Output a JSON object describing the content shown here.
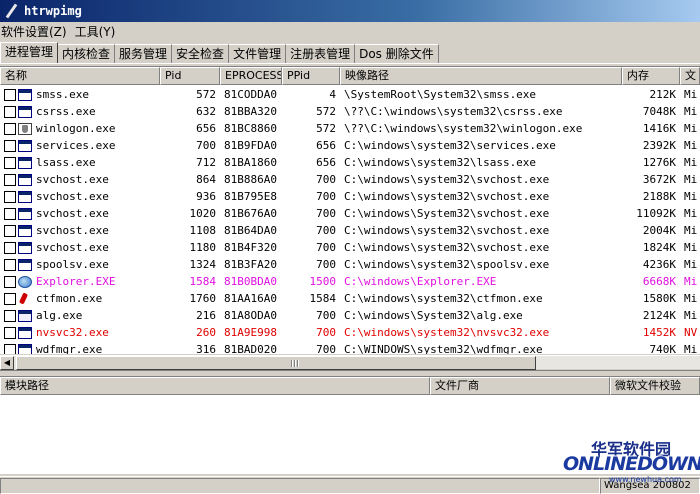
{
  "window": {
    "title": "htrwpimg"
  },
  "menu": [
    "软件设置(Z)",
    "工具(Y)"
  ],
  "tabs": [
    "进程管理",
    "内核检查",
    "服务管理",
    "安全检查",
    "文件管理",
    "注册表管理",
    "Dos 删除文件"
  ],
  "columns": [
    "名称",
    "Pid",
    "EPROCESS",
    "PPid",
    "映像路径",
    "内存",
    "文"
  ],
  "colors": {
    "highlight_magenta": "#e010e0",
    "highlight_red": "#e00000",
    "title_bar": "#0a246a"
  },
  "processes": [
    {
      "name": "smss.exe",
      "pid": "572",
      "eprocess": "81CODDA0",
      "ppid": "4",
      "path": "\\SystemRoot\\System32\\smss.exe",
      "mem": "212K",
      "ver": "Mi",
      "icon": "window-icon",
      "color": ""
    },
    {
      "name": "csrss.exe",
      "pid": "632",
      "eprocess": "81BBA320",
      "ppid": "572",
      "path": "\\??\\C:\\windows\\system32\\csrss.exe",
      "mem": "7048K",
      "ver": "Mi",
      "icon": "window-icon",
      "color": ""
    },
    {
      "name": "winlogon.exe",
      "pid": "656",
      "eprocess": "81BC8860",
      "ppid": "572",
      "path": "\\??\\C:\\windows\\system32\\winlogon.exe",
      "mem": "1416K",
      "ver": "Mi",
      "icon": "shield-icon",
      "color": ""
    },
    {
      "name": "services.exe",
      "pid": "700",
      "eprocess": "81B9FDA0",
      "ppid": "656",
      "path": "C:\\windows\\system32\\services.exe",
      "mem": "2392K",
      "ver": "Mi",
      "icon": "window-icon",
      "color": ""
    },
    {
      "name": "lsass.exe",
      "pid": "712",
      "eprocess": "81BA1860",
      "ppid": "656",
      "path": "C:\\windows\\system32\\lsass.exe",
      "mem": "1276K",
      "ver": "Mi",
      "icon": "window-icon",
      "color": ""
    },
    {
      "name": "svchost.exe",
      "pid": "864",
      "eprocess": "81B886A0",
      "ppid": "700",
      "path": "C:\\windows\\system32\\svchost.exe",
      "mem": "3672K",
      "ver": "Mi",
      "icon": "window-icon",
      "color": ""
    },
    {
      "name": "svchost.exe",
      "pid": "936",
      "eprocess": "81B795E8",
      "ppid": "700",
      "path": "C:\\windows\\system32\\svchost.exe",
      "mem": "2188K",
      "ver": "Mi",
      "icon": "window-icon",
      "color": ""
    },
    {
      "name": "svchost.exe",
      "pid": "1020",
      "eprocess": "81B676A0",
      "ppid": "700",
      "path": "C:\\windows\\System32\\svchost.exe",
      "mem": "11092K",
      "ver": "Mi",
      "icon": "window-icon",
      "color": ""
    },
    {
      "name": "svchost.exe",
      "pid": "1108",
      "eprocess": "81B64DA0",
      "ppid": "700",
      "path": "C:\\windows\\system32\\svchost.exe",
      "mem": "2004K",
      "ver": "Mi",
      "icon": "window-icon",
      "color": ""
    },
    {
      "name": "svchost.exe",
      "pid": "1180",
      "eprocess": "81B4F320",
      "ppid": "700",
      "path": "C:\\windows\\system32\\svchost.exe",
      "mem": "1824K",
      "ver": "Mi",
      "icon": "window-icon",
      "color": ""
    },
    {
      "name": "spoolsv.exe",
      "pid": "1324",
      "eprocess": "81B3FA20",
      "ppid": "700",
      "path": "C:\\windows\\system32\\spoolsv.exe",
      "mem": "4236K",
      "ver": "Mi",
      "icon": "window-icon",
      "color": ""
    },
    {
      "name": "Explorer.EXE",
      "pid": "1584",
      "eprocess": "81B0BDA0",
      "ppid": "1500",
      "path": "C:\\windows\\Explorer.EXE",
      "mem": "6668K",
      "ver": "Mi",
      "icon": "globe-icon",
      "color": "#e010e0"
    },
    {
      "name": "ctfmon.exe",
      "pid": "1760",
      "eprocess": "81AA16A0",
      "ppid": "1584",
      "path": "C:\\windows\\system32\\ctfmon.exe",
      "mem": "1580K",
      "ver": "Mi",
      "icon": "ctfmon-icon",
      "color": ""
    },
    {
      "name": "alg.exe",
      "pid": "216",
      "eprocess": "81A8ODA0",
      "ppid": "700",
      "path": "C:\\windows\\System32\\alg.exe",
      "mem": "2124K",
      "ver": "Mi",
      "icon": "alg-icon",
      "color": ""
    },
    {
      "name": "nvsvc32.exe",
      "pid": "260",
      "eprocess": "81A9E998",
      "ppid": "700",
      "path": "C:\\windows\\system32\\nvsvc32.exe",
      "mem": "1452K",
      "ver": "NV",
      "icon": "window-icon",
      "color": "#e00000"
    },
    {
      "name": "wdfmgr.exe",
      "pid": "316",
      "eprocess": "81BAD020",
      "ppid": "700",
      "path": "C:\\WINDOWS\\system32\\wdfmgr.exe",
      "mem": "740K",
      "ver": "Mi",
      "icon": "window-icon",
      "color": ""
    }
  ],
  "module_columns": [
    "模块路径",
    "文件厂商",
    "微软文件校验"
  ],
  "status": [
    "",
    "Wangsea 200802"
  ],
  "watermark": {
    "cn": "华军软件园",
    "en": "ONLINEDOWN",
    "url": "www.newhua.com"
  }
}
